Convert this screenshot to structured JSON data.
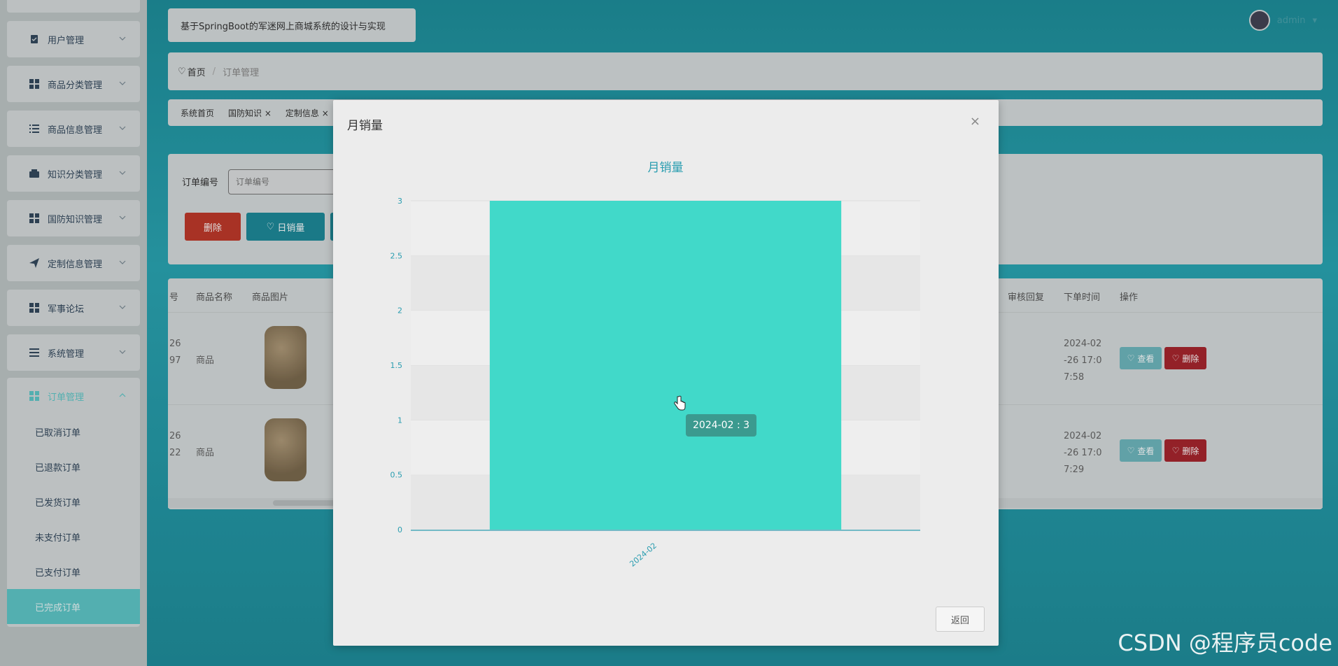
{
  "app": {
    "title": "基于SpringBoot的军迷网上商城系统的设计与实现"
  },
  "user": {
    "name": "admin"
  },
  "sidebar": {
    "items": [
      {
        "label": "用户管理",
        "icon": "clipboard-icon"
      },
      {
        "label": "商品分类管理",
        "icon": "grid-icon"
      },
      {
        "label": "商品信息管理",
        "icon": "list-icon"
      },
      {
        "label": "知识分类管理",
        "icon": "wallet-icon"
      },
      {
        "label": "国防知识管理",
        "icon": "grid-icon"
      },
      {
        "label": "定制信息管理",
        "icon": "send-icon"
      },
      {
        "label": "军事论坛",
        "icon": "grid-icon"
      },
      {
        "label": "系统管理",
        "icon": "menu-icon"
      }
    ],
    "open": {
      "label": "订单管理",
      "subitems": [
        "已取消订单",
        "已退款订单",
        "已发货订单",
        "未支付订单",
        "已支付订单",
        "已完成订单"
      ],
      "active_index": 5
    }
  },
  "breadcrumb": {
    "home": "首页",
    "current": "订单管理"
  },
  "tabs": [
    "系统首页",
    "国防知识",
    "定制信息"
  ],
  "search": {
    "label": "订单编号",
    "placeholder": "订单编号"
  },
  "buttons": {
    "delete": "删除",
    "daily_sales": "日销量"
  },
  "table": {
    "headers": [
      "号",
      "商品名称",
      "商品图片",
      "审核回复",
      "下单时间",
      "操作"
    ],
    "rows": [
      {
        "id_part": "26\n97",
        "name": "商品",
        "time": "2024-02\n-26 17:0\n7:58"
      },
      {
        "id_part": "26\n22",
        "name": "商品",
        "time": "2024-02\n-26 17:0\n7:29"
      }
    ],
    "view_label": "查看",
    "delete_label": "删除"
  },
  "modal": {
    "title": "月销量",
    "close": "×",
    "back_label": "返回"
  },
  "chart_data": {
    "type": "bar",
    "title": "月销量",
    "categories": [
      "2024-02"
    ],
    "values": [
      3
    ],
    "ylim": [
      0,
      3
    ],
    "yticks": [
      0,
      0.5,
      1,
      1.5,
      2,
      2.5,
      3
    ],
    "tooltip": "2024-02 : 3",
    "bar_color": "#41d9c9",
    "axis_color": "#2a9db0"
  },
  "watermark": "CSDN @程序员code"
}
